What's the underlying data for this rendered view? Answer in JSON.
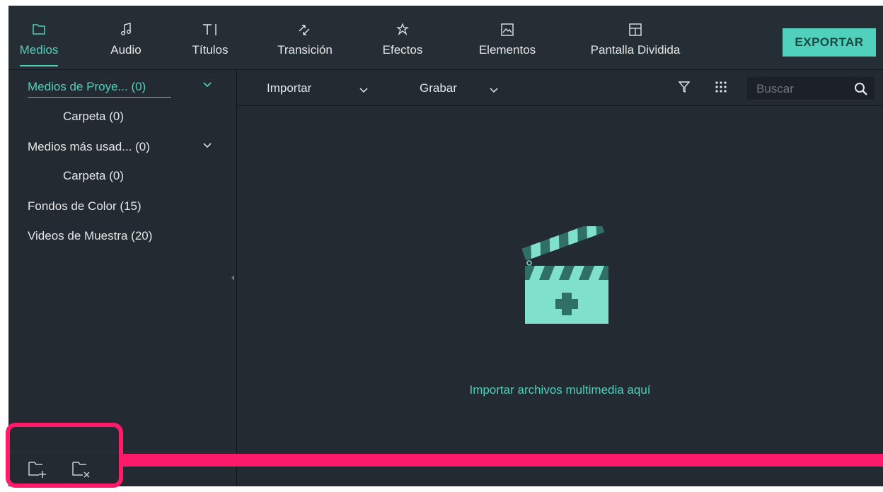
{
  "nav": {
    "tabs": [
      {
        "label": "Medios",
        "icon": "folder-icon",
        "active": true
      },
      {
        "label": "Audio",
        "icon": "music-note-icon",
        "active": false
      },
      {
        "label": "Títulos",
        "icon": "text-title-icon",
        "active": false
      },
      {
        "label": "Transición",
        "icon": "transition-icon",
        "active": false
      },
      {
        "label": "Efectos",
        "icon": "effects-icon",
        "active": false
      },
      {
        "label": "Elementos",
        "icon": "image-elements-icon",
        "active": false
      },
      {
        "label": "Pantalla Dividida",
        "icon": "split-screen-icon",
        "active": false
      }
    ],
    "export_label": "EXPORTAR"
  },
  "sidebar": {
    "items": [
      {
        "label": "Medios de Proye... (0)",
        "active": true,
        "expandable": true
      },
      {
        "label": "Carpeta (0)",
        "active": false,
        "indent": true
      },
      {
        "label": "Medios más usad... (0)",
        "active": false,
        "expandable": true
      },
      {
        "label": "Carpeta (0)",
        "active": false,
        "indent": true
      },
      {
        "label": "Fondos de Color (15)",
        "active": false
      },
      {
        "label": "Videos de Muestra (20)",
        "active": false
      }
    ],
    "bottom_icons": [
      "new-folder-icon",
      "delete-folder-icon"
    ]
  },
  "toolbar": {
    "import_label": "Importar",
    "record_label": "Grabar",
    "search_placeholder": "Buscar"
  },
  "main": {
    "import_hint": "Importar archivos multimedia aquí"
  },
  "colors": {
    "accent": "#4fd1bd",
    "background": "#232a31",
    "annotation": "#ff1a6a"
  }
}
